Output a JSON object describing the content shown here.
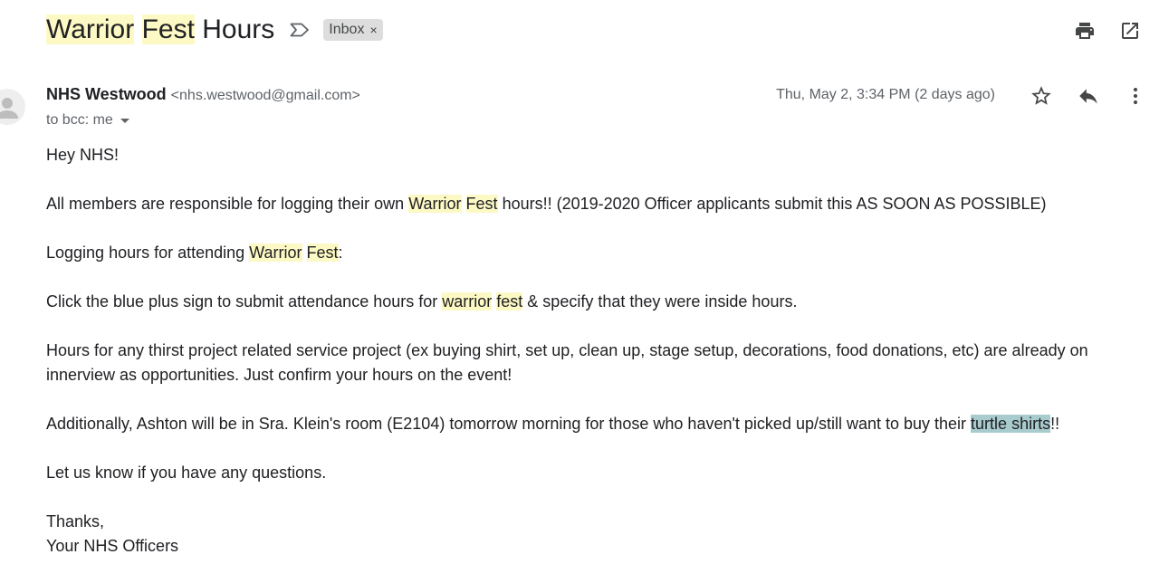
{
  "subject": {
    "word1": "Warrior",
    "word2": "Fest",
    "word3": "Hours"
  },
  "label_chip": {
    "text": "Inbox",
    "remove": "×"
  },
  "icons": {
    "label": "label-outline-icon",
    "print": "print-icon",
    "open_new_window": "open-in-new-window-icon",
    "avatar": "person-icon",
    "star": "star-outline-icon",
    "reply": "reply-icon",
    "more": "more-vertical-icon",
    "caret": "caret-down-icon"
  },
  "colors": {
    "search_highlight": "#fdf9c4",
    "selection_highlight": "#a8cbcd",
    "chip_bg": "#dddddd",
    "text_primary": "#202124",
    "text_secondary": "#5f6368"
  },
  "message": {
    "sender_name": "NHS Westwood",
    "sender_email": "<nhs.westwood@gmail.com>",
    "recipients": "to bcc: me",
    "date": "Thu, May 2, 3:34 PM (2 days ago)",
    "body": {
      "greeting": "Hey NHS!",
      "p1_a": "All members are responsible for logging their own ",
      "p1_hl1": "Warrior",
      "p1_sp": " ",
      "p1_hl2": "Fest",
      "p1_b": " hours!! (2019-2020 Officer applicants submit this AS SOON AS POSSIBLE)",
      "p2_a": "Logging hours for attending ",
      "p2_hl1": "Warrior",
      "p2_sp": " ",
      "p2_hl2": "Fest",
      "p2_b": ":",
      "p3_a": "Click the blue plus sign to submit attendance hours for ",
      "p3_hl1": "warrior",
      "p3_sp": " ",
      "p3_hl2": "fest",
      "p3_b": " & specify that they were inside hours.",
      "p4": "Hours for any thirst project related service project (ex buying shirt, set up, clean up, stage setup, decorations, food donations, etc) are already on innerview as opportunities. Just confirm your hours on the event!",
      "p5_a": "Additionally, Ashton will be in Sra. Klein's room (E2104) tomorrow morning for those who haven't picked up/still want to buy their ",
      "p5_hl": "turtle shirts",
      "p5_b": "!!",
      "p6": "Let us know if you have any questions.",
      "signoff1": "Thanks,",
      "signoff2": "Your NHS Officers"
    }
  }
}
